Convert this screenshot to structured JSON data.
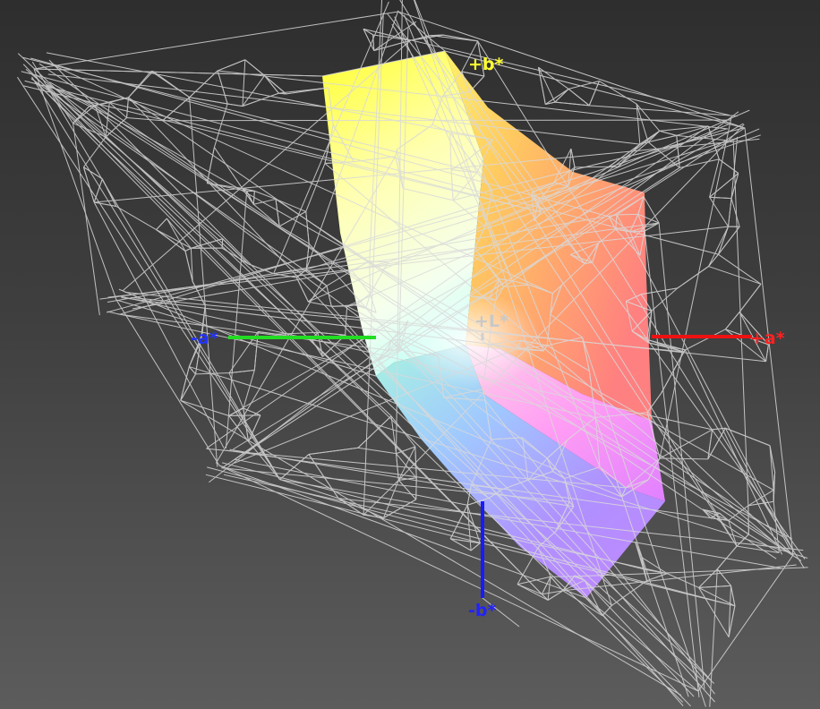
{
  "viewer": {
    "kind": "3D Lab gamut comparison",
    "background": "#3a3a3a",
    "wireframe_color": "#d8d8d8"
  },
  "axes": {
    "plus_b": {
      "label": "+b*",
      "color": "#ffff33"
    },
    "minus_b": {
      "label": "-b*",
      "color": "#1a1aff"
    },
    "plus_a": {
      "label": "+a*",
      "color": "#ff2020"
    },
    "minus_a": {
      "label": "-a*",
      "color": "#2233ff"
    },
    "plus_L": {
      "label": "+L*",
      "color": "#c8c8c8"
    }
  },
  "gamut_colors": {
    "yellow": "#ffff33",
    "orange": "#ffa040",
    "red": "#ff6060",
    "magenta": "#ff80ff",
    "violet": "#b080ff",
    "blue": "#8080ff",
    "cyan": "#80e0ff",
    "green": "#c0ffc0",
    "white": "#ffffee"
  }
}
